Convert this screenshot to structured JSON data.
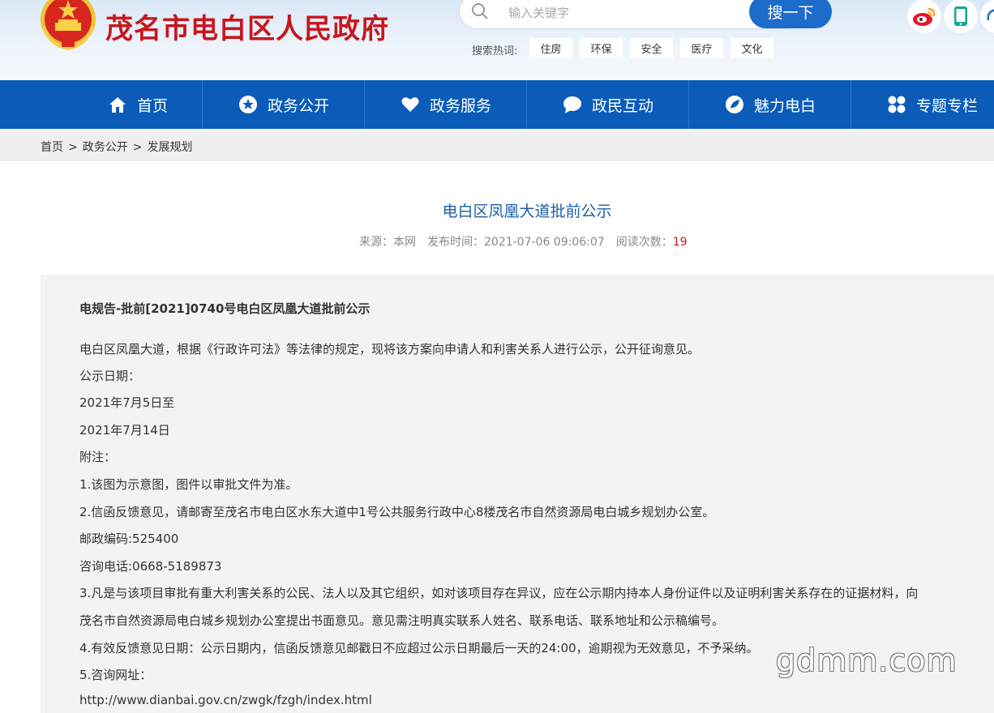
{
  "header": {
    "site_title": "茂名市电白区人民政府",
    "search_placeholder": "输入关键字",
    "search_button": "搜一下",
    "hot_label": "搜索热词:",
    "hot_tags": [
      "住房",
      "环保",
      "安全",
      "医疗",
      "文化"
    ],
    "social_icons": [
      "weibo-icon",
      "mobile-icon",
      "wechat-icon"
    ],
    "colors": {
      "title_red": "#c8161d",
      "nav_blue": "#0a5cb8",
      "button_blue": "#1d6ccb"
    }
  },
  "nav": {
    "items": [
      {
        "label": "首页",
        "icon": "home-icon"
      },
      {
        "label": "政务公开",
        "icon": "star-icon"
      },
      {
        "label": "政务服务",
        "icon": "heart-icon"
      },
      {
        "label": "政民互动",
        "icon": "chat-bubble-icon"
      },
      {
        "label": "魅力电白",
        "icon": "leaf-icon"
      },
      {
        "label": "专题专栏",
        "icon": "grid-icon"
      }
    ]
  },
  "breadcrumb": {
    "items": [
      "首页",
      "政务公开",
      "发展规划"
    ],
    "separator": ">"
  },
  "article": {
    "title": "电白区凤凰大道批前公示",
    "source_label": "来源：",
    "source": "本网",
    "time_label": "发布时间：",
    "time": "2021-07-06 09:06:07",
    "reads_label": "阅读次数：",
    "reads": "19",
    "doc_number": "电规告-批前[2021]0740号电白区凤凰大道批前公示",
    "paragraphs": [
      "电白区凤凰大道，根据《行政许可法》等法律的规定，现将该方案向申请人和利害关系人进行公示，公开征询意见。",
      "公示日期：",
      "2021年7月5日至",
      "2021年7月14日",
      "附注：",
      "1.该图为示意图，图件以审批文件为准。",
      "2.信函反馈意见，请邮寄至茂名市电白区水东大道中1号公共服务行政中心8楼茂名市自然资源局电白城乡规划办公室。",
      "邮政编码:525400",
      "咨询电话:0668-5189873",
      "3.凡是与该项目审批有重大利害关系的公民、法人以及其它组织，如对该项目存在异议，应在公示期内持本人身份证件以及证明利害关系存在的证据材料，向",
      "茂名市自然资源局电白城乡规划办公室提出书面意见。意见需注明真实联系人姓名、联系电话、联系地址和公示稿编号。",
      "4.有效反馈意见日期：公示日期内，信函反馈意见邮戳日不应超过公示日期最后一天的24:00，逾期视为无效意见，不予采纳。",
      "5.咨询网址：",
      "http://www.dianbai.gov.cn/zwgk/fzgh/index.html"
    ]
  },
  "watermark": "gdmm.com"
}
